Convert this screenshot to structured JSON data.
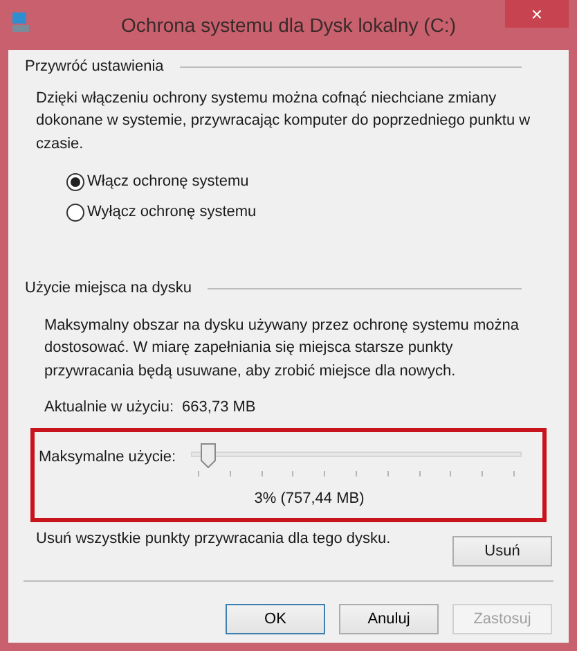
{
  "window": {
    "title": "Ochrona systemu dla Dysk lokalny (C:)",
    "close": "×"
  },
  "restore": {
    "heading": "Przywróć ustawienia",
    "description": "Dzięki włączeniu ochrony systemu można cofnąć niechciane zmiany dokonane w systemie, przywracając komputer do poprzedniego punktu w czasie.",
    "options": [
      {
        "label": "Włącz ochronę systemu",
        "selected": true
      },
      {
        "label": "Wyłącz ochronę systemu",
        "selected": false
      }
    ]
  },
  "disk_usage": {
    "heading": "Użycie miejsca na dysku",
    "description": "Maksymalny obszar na dysku używany przez ochronę systemu można dostosować. W miarę zapełniania się miejsca starsze punkty przywracania będą usuwane, aby zrobić miejsce dla nowych.",
    "current_label": "Aktualnie w użyciu:",
    "current_value": "663,73 MB",
    "max_label": "Maksymalne użycie:",
    "max_slider": {
      "level": 0.03
    },
    "max_reading": "3% (757,44 MB)",
    "delete_text": "Usuń wszystkie punkty przywracania dla tego dysku.",
    "delete_button": "Usuń"
  },
  "buttons": [
    {
      "label": "OK",
      "kind": "default",
      "disabled": false
    },
    {
      "label": "Anuluj",
      "kind": "normal",
      "disabled": false
    },
    {
      "label": "Zastosuj",
      "kind": "normal",
      "disabled": true
    }
  ]
}
